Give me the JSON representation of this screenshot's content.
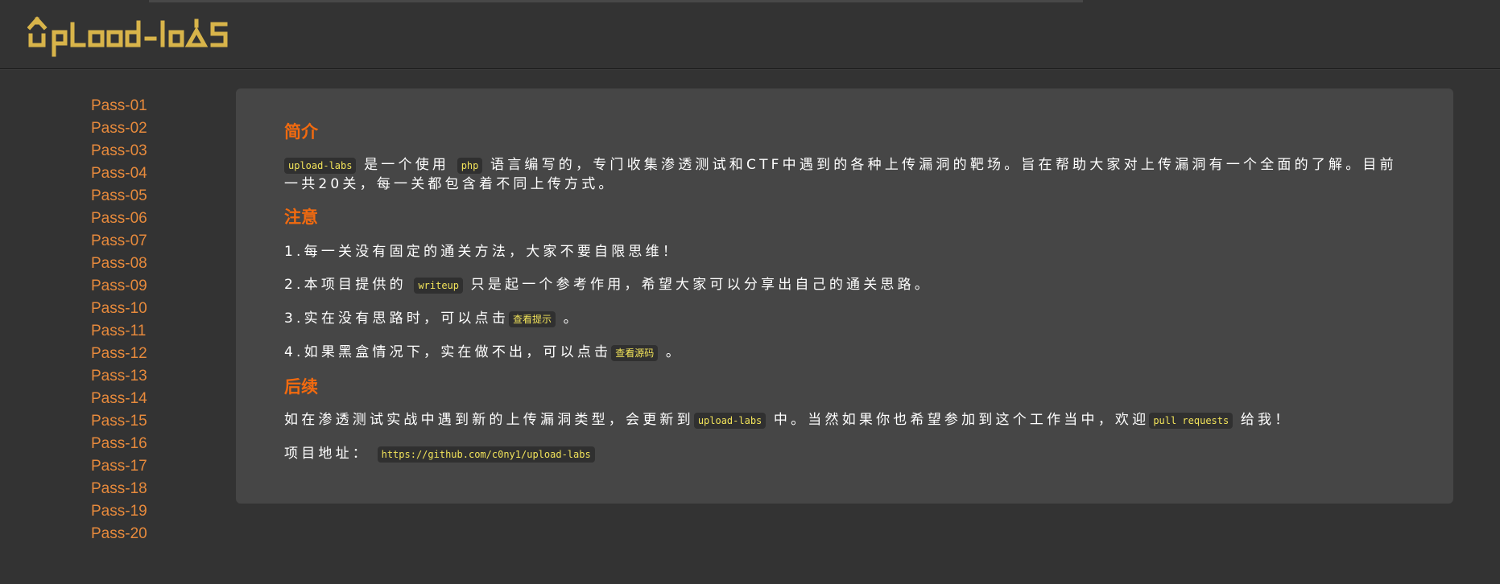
{
  "app": {
    "title": "Upload-labs",
    "accent": "#f26a0f",
    "link_color": "#e78a3c",
    "code_color": "#f2e35a"
  },
  "sidebar": {
    "items": [
      "Pass-01",
      "Pass-02",
      "Pass-03",
      "Pass-04",
      "Pass-05",
      "Pass-06",
      "Pass-07",
      "Pass-08",
      "Pass-09",
      "Pass-10",
      "Pass-11",
      "Pass-12",
      "Pass-13",
      "Pass-14",
      "Pass-15",
      "Pass-16",
      "Pass-17",
      "Pass-18",
      "Pass-19",
      "Pass-20"
    ]
  },
  "intro": {
    "heading": "简介",
    "code1": "upload-labs",
    "text1": "是一个使用",
    "code2": "php",
    "text2": "语言编写的，专门收集渗透测试和CTF中遇到的各种上传漏洞的靶场。旨在帮助大家对上传漏洞有一个全面的了解。目前一共20关，每一关都包含着不同上传方式。"
  },
  "notes": {
    "heading": "注意",
    "n1": "1.每一关没有固定的通关方法，大家不要自限思维！",
    "n2_pre": "2.本项目提供的",
    "n2_code": "writeup",
    "n2_post": "只是起一个参考作用，希望大家可以分享出自己的通关思路。",
    "n3_pre": "3.实在没有思路时，可以点击",
    "n3_code": "查看提示",
    "n3_post": "。",
    "n4_pre": "4.如果黑盒情况下，实在做不出，可以点击",
    "n4_code": "查看源码",
    "n4_post": "。"
  },
  "followup": {
    "heading": "后续",
    "t1": "如在渗透测试实战中遇到新的上传漏洞类型，会更新到",
    "c1": "upload-labs",
    "t2": "中。当然如果你也希望参加到这个工作当中，欢迎",
    "c2": "pull requests",
    "t3": "给我！",
    "addr_label": "项目地址：",
    "addr_url": "https://github.com/c0ny1/upload-labs"
  }
}
